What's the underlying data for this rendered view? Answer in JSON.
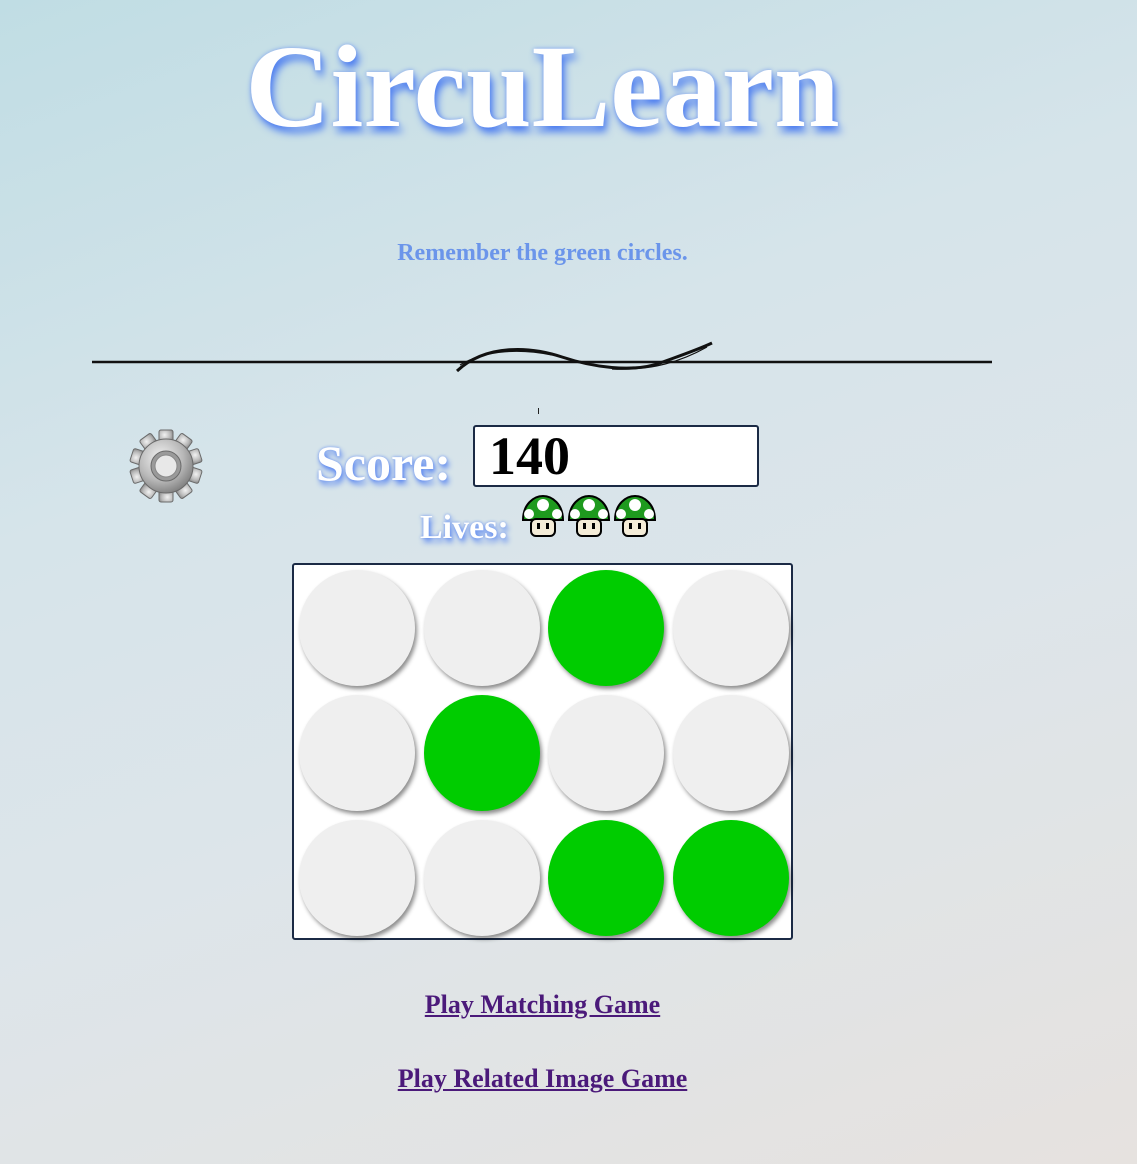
{
  "app": {
    "title": "CircuLearn",
    "instruction": "Remember the green circles."
  },
  "score": {
    "label": "Score:",
    "value": "140"
  },
  "lives": {
    "label": "Lives:",
    "count": 3,
    "icon": "green-mushroom-icon"
  },
  "board": {
    "rows": 3,
    "cols": 4,
    "cells": [
      [
        false,
        false,
        true,
        false
      ],
      [
        false,
        true,
        false,
        false
      ],
      [
        false,
        false,
        true,
        true
      ]
    ],
    "on_color": "#00cc00",
    "off_color": "#efefef"
  },
  "links": {
    "matching": "Play Matching Game",
    "related_image": "Play Related Image Game"
  },
  "colors": {
    "title_glow": "#4f7ff0",
    "subtitle": "#6b95ea",
    "link": "#4b1a7a"
  }
}
